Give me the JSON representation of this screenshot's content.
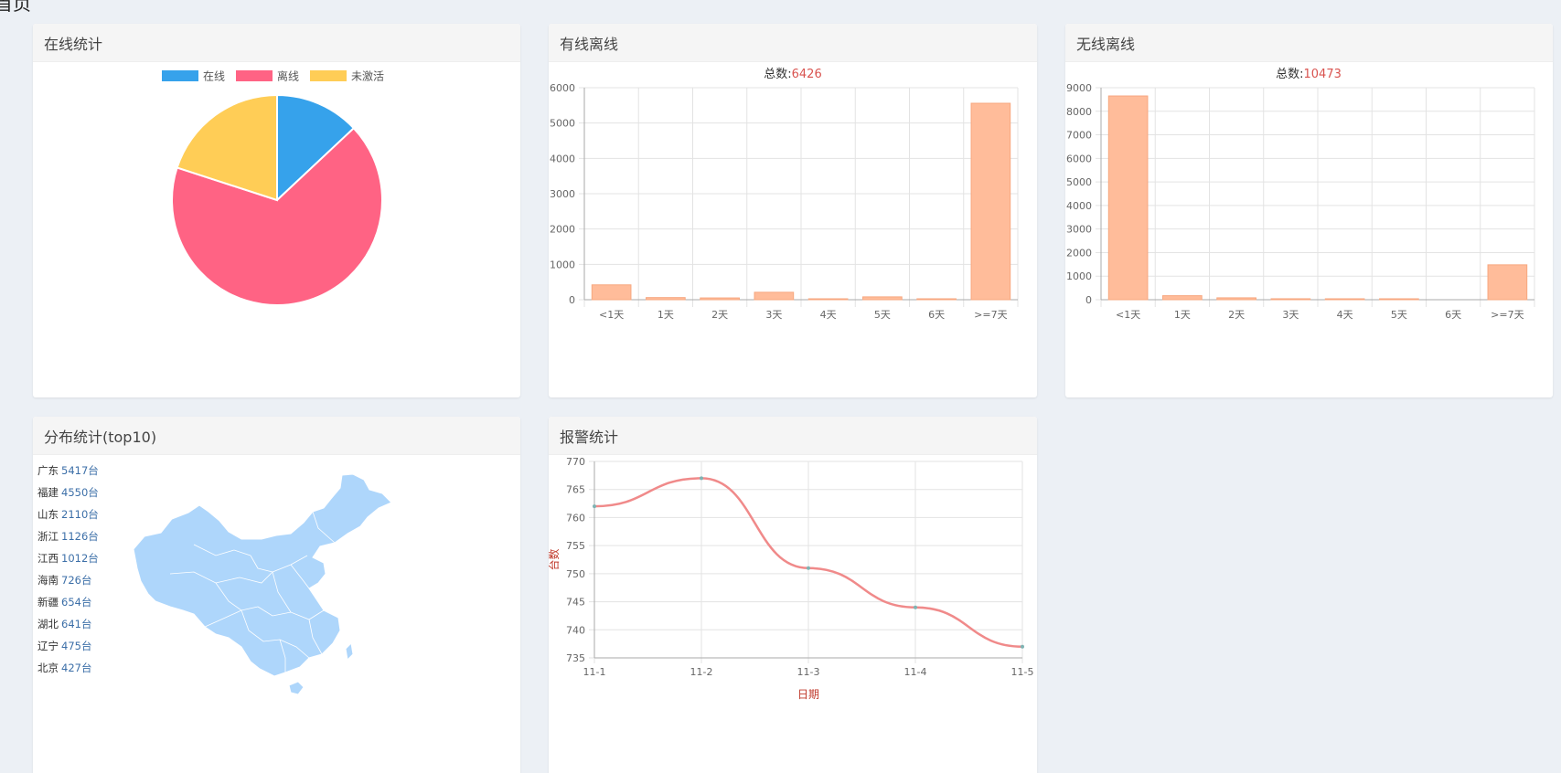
{
  "page": {
    "title": "首页"
  },
  "colors": {
    "online": "#36a2eb",
    "offline": "#ff6384",
    "inactive": "#ffcd56",
    "bar": "#ffbc9a",
    "line": "#f08a8a",
    "total_value": "#d9534f",
    "axis_title": "#c0392b",
    "map": "#aed6fb"
  },
  "panels": {
    "online": {
      "title": "在线统计"
    },
    "wired": {
      "title": "有线离线",
      "total_label": "总数:",
      "total_value": "6426"
    },
    "wireless": {
      "title": "无线离线",
      "total_label": "总数:",
      "total_value": "10473"
    },
    "distribution": {
      "title": "分布统计(top10)",
      "items": [
        {
          "province": "广东",
          "count": "5417台"
        },
        {
          "province": "福建",
          "count": "4550台"
        },
        {
          "province": "山东",
          "count": "2110台"
        },
        {
          "province": "浙江",
          "count": "1126台"
        },
        {
          "province": "江西",
          "count": "1012台"
        },
        {
          "province": "海南",
          "count": "726台"
        },
        {
          "province": "新疆",
          "count": "654台"
        },
        {
          "province": "湖北",
          "count": "641台"
        },
        {
          "province": "辽宁",
          "count": "475台"
        },
        {
          "province": "北京",
          "count": "427台"
        }
      ]
    },
    "alarm": {
      "title": "报警统计"
    }
  },
  "chart_data": [
    {
      "type": "pie",
      "labels": [
        "在线",
        "离线",
        "未激活"
      ],
      "values": [
        13,
        67,
        20
      ],
      "legend": "top"
    },
    {
      "type": "bar",
      "title": "总数:6426",
      "categories": [
        "<1天",
        "1天",
        "2天",
        "3天",
        "4天",
        "5天",
        "6天",
        ">=7天"
      ],
      "values": [
        420,
        60,
        50,
        210,
        20,
        80,
        20,
        5560
      ],
      "ylim": [
        0,
        6000
      ],
      "yticks": [
        0,
        1000,
        2000,
        3000,
        4000,
        5000,
        6000
      ],
      "grid": true
    },
    {
      "type": "bar",
      "title": "总数:10473",
      "categories": [
        "<1天",
        "1天",
        "2天",
        "3天",
        "4天",
        "5天",
        "6天",
        ">=7天"
      ],
      "values": [
        8650,
        170,
        80,
        40,
        30,
        20,
        0,
        1480
      ],
      "ylim": [
        0,
        9000
      ],
      "yticks": [
        0,
        1000,
        2000,
        3000,
        4000,
        5000,
        6000,
        7000,
        8000,
        9000
      ],
      "grid": true
    },
    {
      "type": "line",
      "x": [
        "11-1",
        "11-2",
        "11-3",
        "11-4",
        "11-5"
      ],
      "values": [
        762,
        767,
        751,
        744,
        737
      ],
      "xlabel": "日期",
      "ylabel": "台数",
      "ylim": [
        735,
        770
      ],
      "yticks": [
        735,
        740,
        745,
        750,
        755,
        760,
        765,
        770
      ],
      "grid": true
    }
  ]
}
